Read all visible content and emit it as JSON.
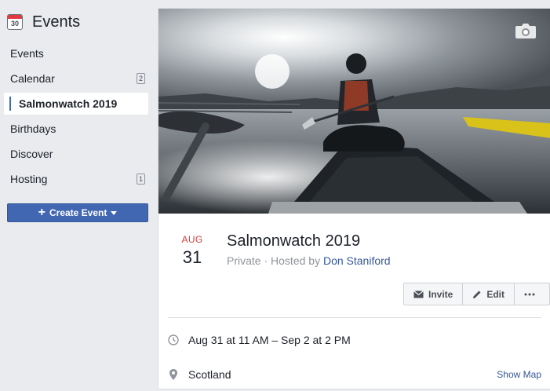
{
  "sidebar": {
    "title": "Events",
    "calendar_icon_day": "30",
    "items": [
      {
        "label": "Events",
        "badge": ""
      },
      {
        "label": "Calendar",
        "badge": "2"
      },
      {
        "label": "Salmonwatch 2019",
        "badge": ""
      },
      {
        "label": "Birthdays",
        "badge": ""
      },
      {
        "label": "Discover",
        "badge": ""
      },
      {
        "label": "Hosting",
        "badge": "1"
      }
    ],
    "create_label": "Create Event"
  },
  "event": {
    "month": "AUG",
    "day": "31",
    "title": "Salmonwatch 2019",
    "privacy": "Private",
    "hosted_by_prefix": "Hosted by",
    "host": "Don Staniford",
    "actions": {
      "invite": "Invite",
      "edit": "Edit"
    },
    "time": "Aug 31 at 11 AM – Sep 2 at 2 PM",
    "location": "Scotland",
    "show_map": "Show Map"
  },
  "icons": [
    "calendar-icon",
    "plus-icon",
    "caret-down-icon",
    "camera-icon",
    "envelope-icon",
    "pencil-icon",
    "more-icon",
    "clock-icon",
    "map-pin-icon"
  ],
  "colors": {
    "accent": "#4267b2",
    "date_red": "#e0393e",
    "link": "#365899",
    "background": "#e9ebee"
  }
}
